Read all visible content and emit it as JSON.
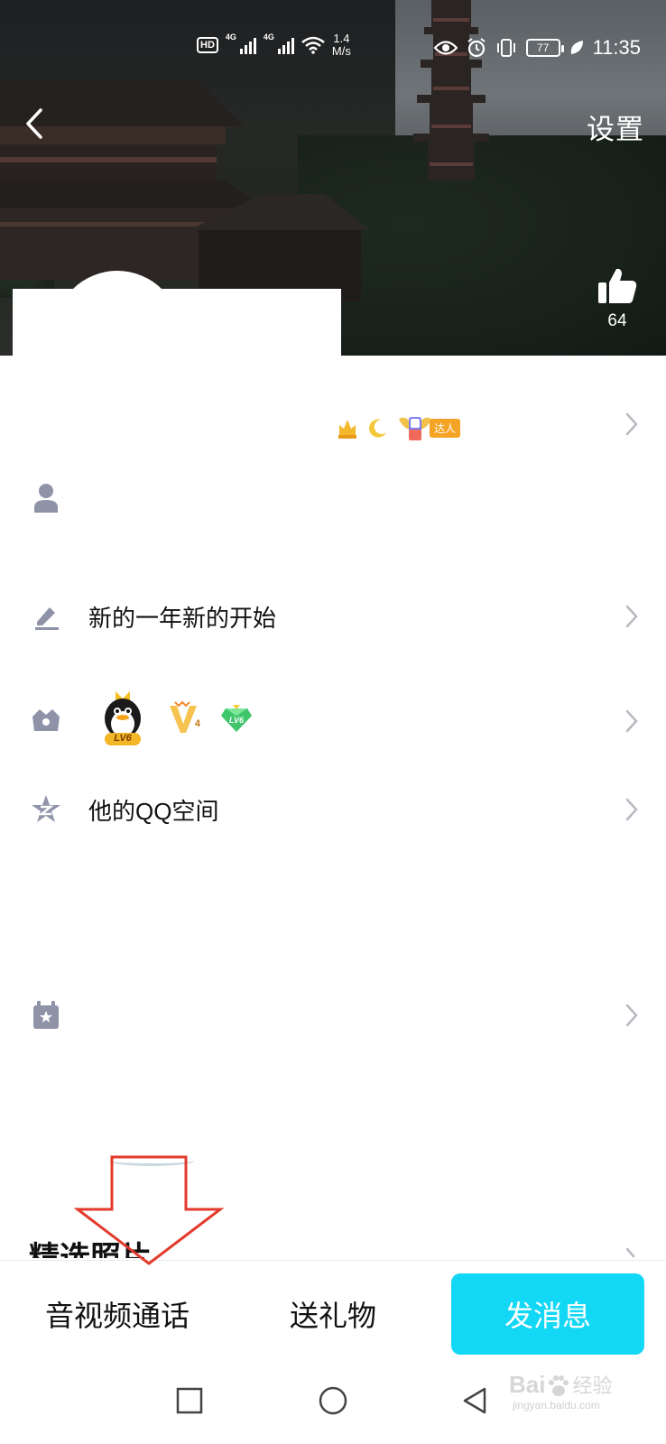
{
  "status_bar": {
    "hd_label": "HD",
    "network_label_1": "4G",
    "network_label_2": "4G",
    "speed_value": "1.4",
    "speed_unit": "M/s",
    "battery": "77",
    "time": "11:35"
  },
  "header": {
    "settings_label": "设置",
    "like_count": "64"
  },
  "profile_rows": [
    {
      "id": "signature",
      "icon": "pencil-icon",
      "label": "新的一年新的开始"
    },
    {
      "id": "badges",
      "icon": "crown-icon"
    },
    {
      "id": "qzone",
      "icon": "qzone-star-icon",
      "label": "他的QQ空间"
    },
    {
      "id": "favorites",
      "icon": "star-calendar-icon"
    }
  ],
  "vip_badges": {
    "penguin_level": "LV6",
    "vip_level": "4",
    "diamond_level": "LV6"
  },
  "top_badges": {
    "expert_label": "达人"
  },
  "section_title": "精选照片",
  "bottom_bar": {
    "call_label": "音视频通话",
    "gift_label": "送礼物",
    "message_label": "发消息"
  },
  "watermark": {
    "brand": "Bai",
    "brand_cn": "经验",
    "url": "jingyan.baidu.com"
  },
  "colors": {
    "accent": "#12d7f5",
    "icon_gray": "#8e93a8",
    "annotation_red": "#e33a2c"
  }
}
